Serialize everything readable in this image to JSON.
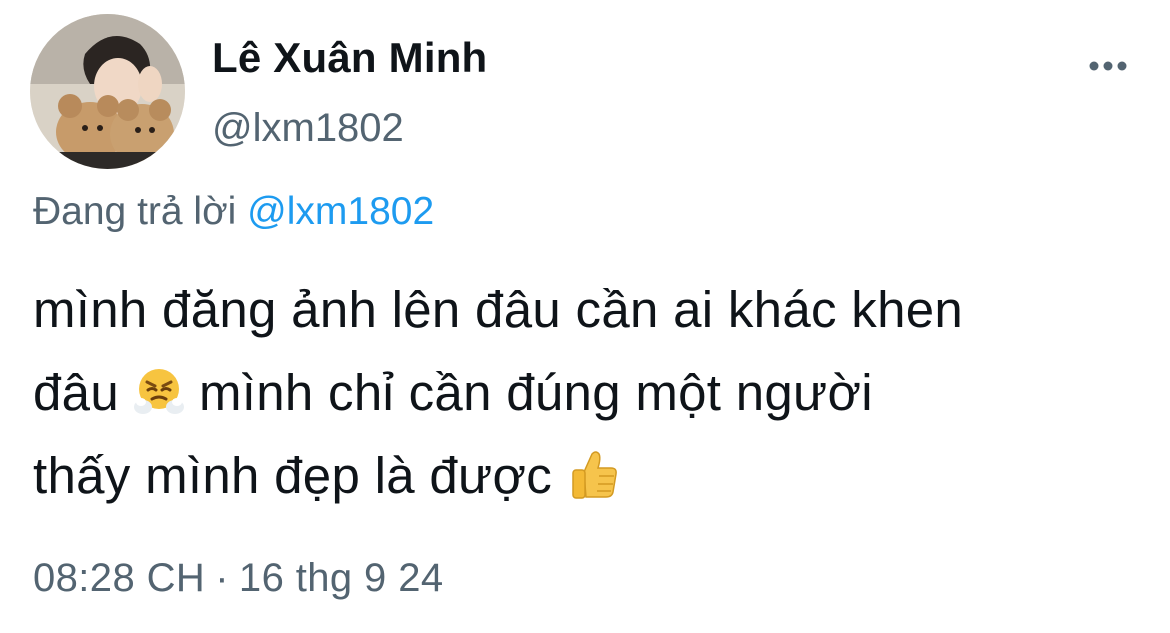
{
  "author": {
    "display_name": "Lê Xuân Minh",
    "handle": "@lxm1802"
  },
  "more_button": {
    "icon": "more-horizontal-icon"
  },
  "reply": {
    "prefix": "Đang trả lời",
    "mention": "@lxm1802"
  },
  "tweet": {
    "line1": "mình đăng ảnh lên đâu cần ai khác khen",
    "line2_part1": "đâu",
    "emoji1": "face-with-steam-from-nose-icon",
    "line2_part2": "mình chỉ cần đúng một người",
    "line3": "thấy mình đẹp là được",
    "emoji2": "thumbs-up-icon"
  },
  "meta": {
    "time": "08:28 CH",
    "separator": "·",
    "date": "16 thg 9 24"
  },
  "colors": {
    "text_primary": "#0f1419",
    "text_secondary": "#536471",
    "link": "#1d9bf0",
    "background": "#ffffff"
  }
}
